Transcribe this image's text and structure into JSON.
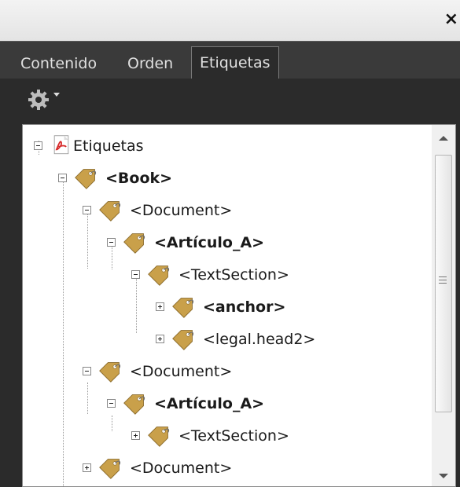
{
  "window": {
    "close_label": "×"
  },
  "tabs": [
    {
      "label": "Contenido",
      "active": false
    },
    {
      "label": "Orden",
      "active": false
    },
    {
      "label": "Etiquetas",
      "active": true
    }
  ],
  "toolbar": {
    "options_icon": "gear-icon"
  },
  "tree": {
    "nodes": [
      {
        "label": "Etiquetas",
        "icon": "pdf-icon",
        "expanded": true,
        "bold": false,
        "depth": 0
      },
      {
        "label": "<Book>",
        "icon": "tag-icon",
        "expanded": true,
        "bold": true,
        "depth": 1
      },
      {
        "label": "<Document>",
        "icon": "tag-icon",
        "expanded": true,
        "bold": false,
        "depth": 2
      },
      {
        "label": "<Artículo_A>",
        "icon": "tag-icon",
        "expanded": true,
        "bold": true,
        "depth": 3
      },
      {
        "label": "<TextSection>",
        "icon": "tag-icon",
        "expanded": true,
        "bold": false,
        "depth": 4
      },
      {
        "label": "<anchor>",
        "icon": "tag-icon",
        "expanded": false,
        "bold": true,
        "depth": 5
      },
      {
        "label": "<legal.head2>",
        "icon": "tag-icon",
        "expanded": false,
        "bold": false,
        "depth": 5
      },
      {
        "label": "<Document>",
        "icon": "tag-icon",
        "expanded": true,
        "bold": false,
        "depth": 2
      },
      {
        "label": "<Artículo_A>",
        "icon": "tag-icon",
        "expanded": true,
        "bold": true,
        "depth": 3
      },
      {
        "label": "<TextSection>",
        "icon": "tag-icon",
        "expanded": false,
        "bold": false,
        "depth": 4
      },
      {
        "label": "<Document>",
        "icon": "tag-icon",
        "expanded": false,
        "bold": false,
        "depth": 2
      }
    ]
  },
  "colors": {
    "panel_bg": "#2b2b2b",
    "tab_text": "#e0e0e0",
    "tag_gold": "#c9a04a",
    "pdf_red": "#d62828"
  }
}
